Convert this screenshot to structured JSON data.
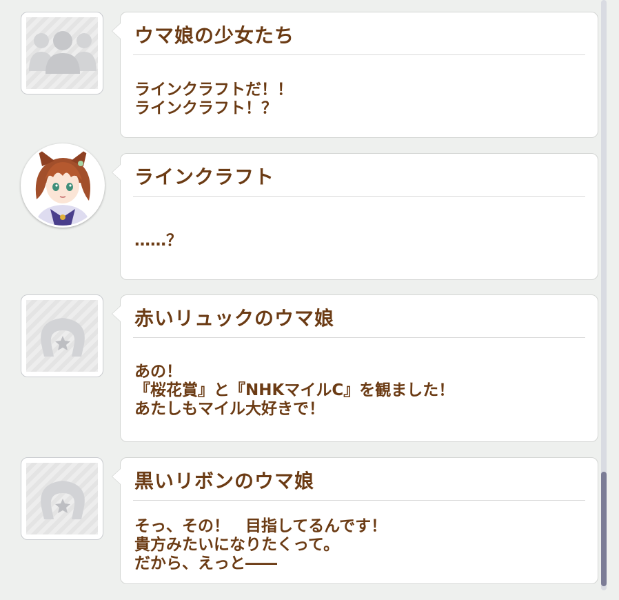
{
  "messages": [
    {
      "speaker": "ウマ娘の少女たち",
      "avatar_icon": "group-silhouette-icon",
      "lines": [
        "ラインクラフトだ！！",
        "ラインクラフト！？"
      ]
    },
    {
      "speaker": "ラインクラフト",
      "avatar_icon": "character-portrait",
      "lines": [
        "……？"
      ]
    },
    {
      "speaker": "赤いリュックのウマ娘",
      "avatar_icon": "horseshoe-star-icon",
      "lines": [
        "あの！",
        "『桜花賞』と『NHKマイルC』を観ました！",
        "あたしもマイル大好きで！"
      ]
    },
    {
      "speaker": "黒いリボンのウマ娘",
      "avatar_icon": "horseshoe-star-icon",
      "lines": [
        "そっ、その！　目指してるんです！",
        "貴方みたいになりたくって。",
        "だから、えっと――"
      ]
    }
  ],
  "colors": {
    "text": "#6b3b14",
    "background": "#eef0ee",
    "bubble": "#ffffff",
    "scrollbar_thumb": "#7b7c96"
  }
}
